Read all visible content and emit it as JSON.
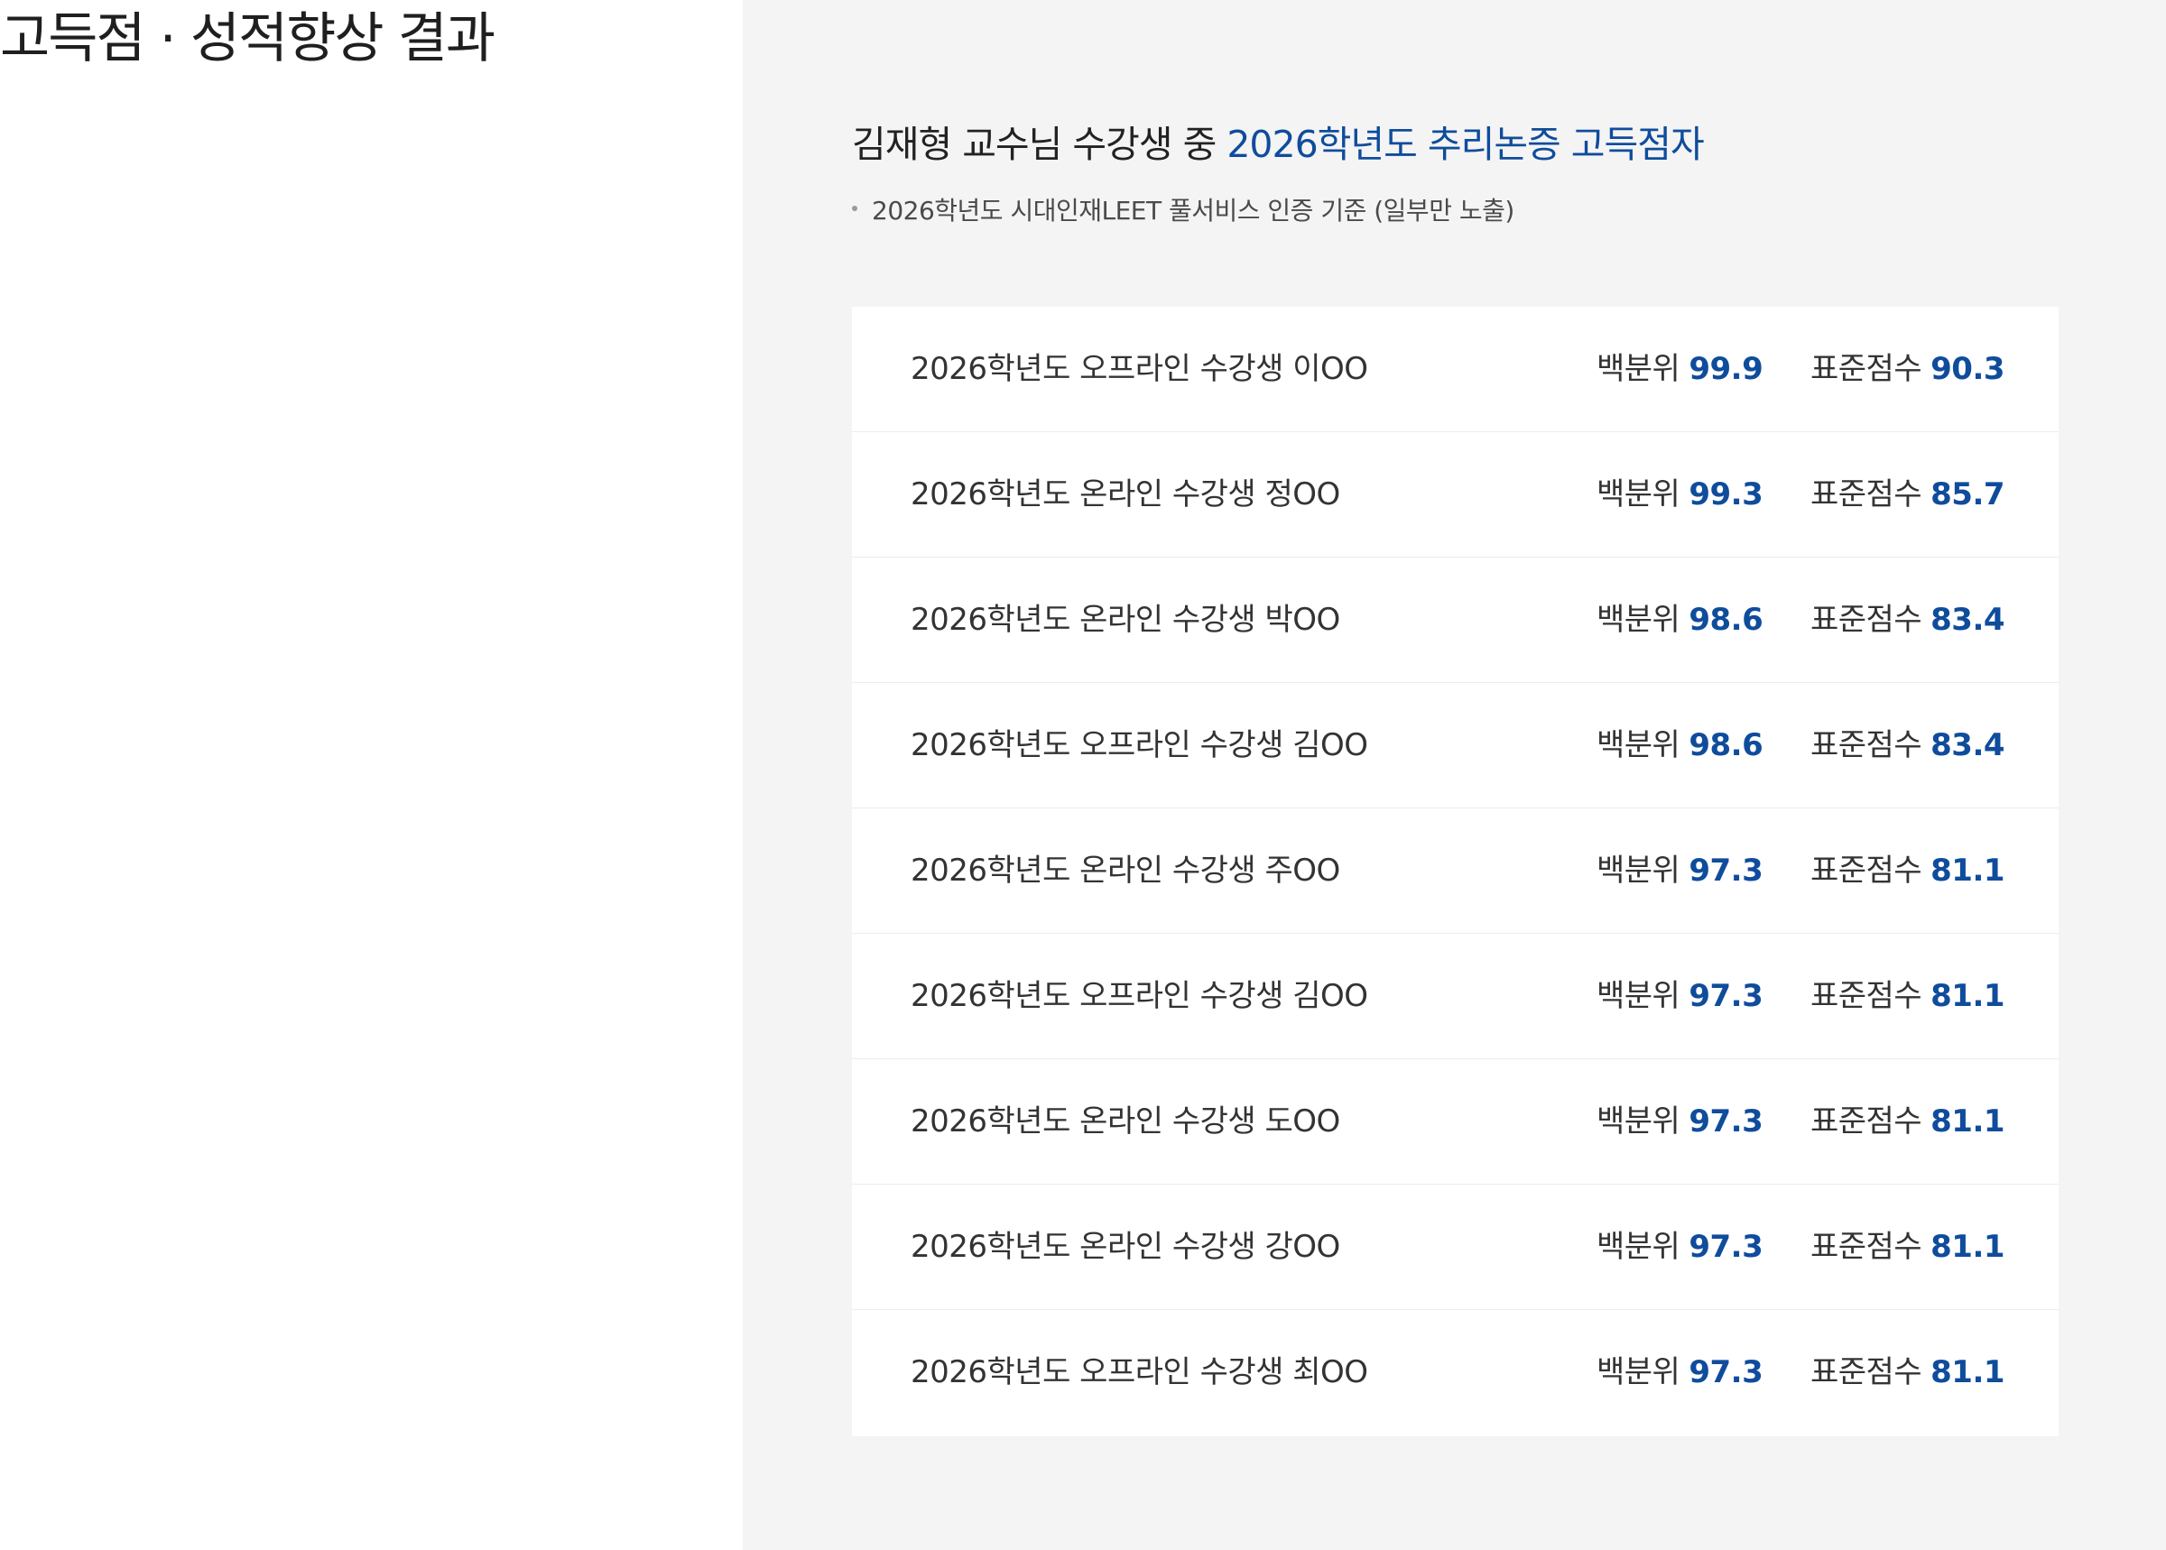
{
  "left": {
    "title": "고득점 · 성적향상 결과"
  },
  "panel": {
    "headline_prefix": "김재형 교수님 수강생 중 ",
    "headline_accent": "2026학년도 추리논증 고득점자",
    "note": "2026학년도 시대인재LEET 풀서비스 인증 기준 (일부만 노출)",
    "percentile_label": "백분위",
    "standard_label": "표준점수",
    "accent_color": "#0f4c9c",
    "rows": [
      {
        "name": "2026학년도 오프라인 수강생 이OO",
        "percentile": "99.9",
        "standard": "90.3"
      },
      {
        "name": "2026학년도 온라인 수강생 정OO",
        "percentile": "99.3",
        "standard": "85.7"
      },
      {
        "name": "2026학년도 온라인 수강생 박OO",
        "percentile": "98.6",
        "standard": "83.4"
      },
      {
        "name": "2026학년도 오프라인 수강생 김OO",
        "percentile": "98.6",
        "standard": "83.4"
      },
      {
        "name": "2026학년도 온라인 수강생 주OO",
        "percentile": "97.3",
        "standard": "81.1"
      },
      {
        "name": "2026학년도 오프라인 수강생 김OO",
        "percentile": "97.3",
        "standard": "81.1"
      },
      {
        "name": "2026학년도 온라인 수강생 도OO",
        "percentile": "97.3",
        "standard": "81.1"
      },
      {
        "name": "2026학년도 온라인 수강생 강OO",
        "percentile": "97.3",
        "standard": "81.1"
      },
      {
        "name": "2026학년도 오프라인 수강생 최OO",
        "percentile": "97.3",
        "standard": "81.1"
      }
    ]
  }
}
